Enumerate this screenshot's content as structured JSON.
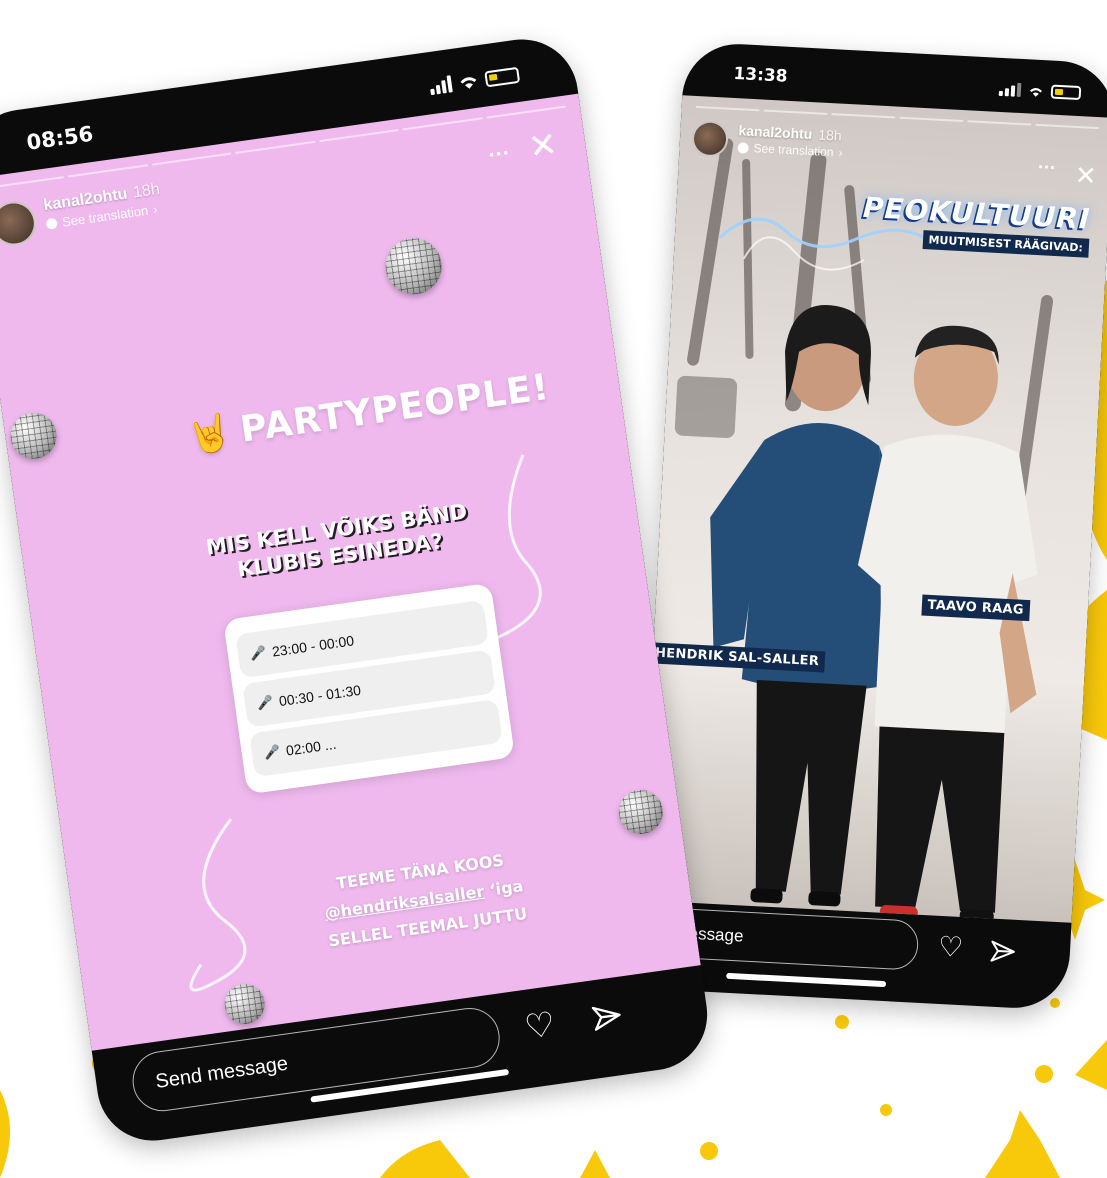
{
  "colors": {
    "accent_yellow": "#f8c80a",
    "story_pink": "#efb9ee",
    "label_navy": "#12294e",
    "phone_black": "#0b0b0b"
  },
  "left_phone": {
    "status": {
      "time": "08:56"
    },
    "story": {
      "account": "kanal2ohtu",
      "age": "18h",
      "see_translation": "See translation",
      "title": "PARTYPEOPLE!",
      "question": "MIS KELL VÕIKS BÄND KLUBIS ESINEDA?",
      "poll_options": [
        "23:00 - 00:00",
        "00:30 - 01:30",
        "02:00 ..."
      ],
      "cta_line1": "TEEME TÄNA KOOS",
      "cta_mention": "@hendriksalsaller",
      "cta_suffix": " ‘iga",
      "cta_line3": "SELLEL TEEMAL JUTTU"
    },
    "send_placeholder": "Send message"
  },
  "right_phone": {
    "status": {
      "time": "13:38"
    },
    "story": {
      "account": "kanal2ohtu",
      "age": "18h",
      "see_translation": "See translation",
      "title": "PEOKULTUURI",
      "subtitle": "MUUTMISEST RÄÄGIVAD:",
      "label_left": "HENDRIK SAL-SALLER",
      "label_right": "TAAVO RAAG"
    },
    "send_placeholder": "end message"
  },
  "icons": {
    "heart": "♡",
    "send": "➤",
    "close": "✕",
    "more": "..."
  }
}
